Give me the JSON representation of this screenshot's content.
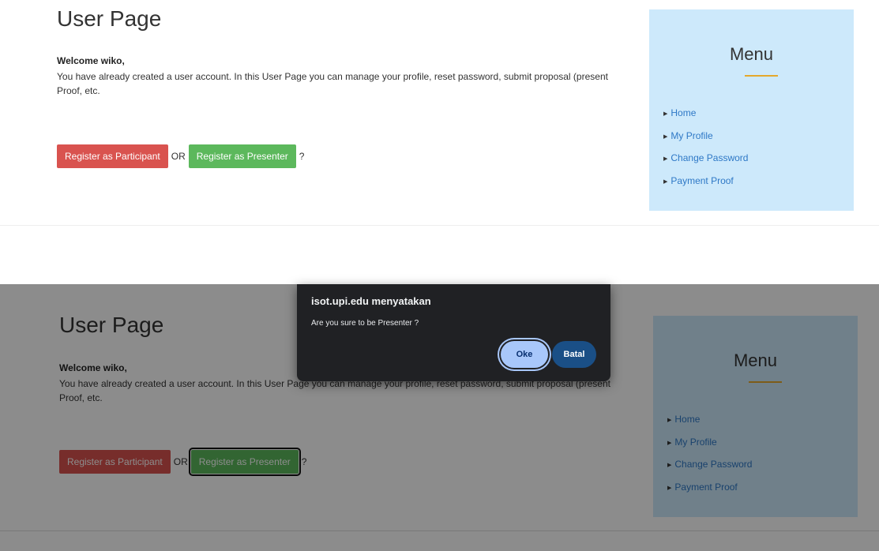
{
  "page": {
    "title": "User Page",
    "welcome": "Welcome wiko,",
    "description": "You have already created a user account. In this User Page you can manage your profile, reset password, submit proposal (present",
    "description_line2": "Proof, etc.",
    "register_participant_label": "Register as Participant",
    "or_text": "OR",
    "register_presenter_label": "Register as Presenter",
    "question_mark": "?"
  },
  "sidebar": {
    "title": "Menu",
    "items": [
      {
        "label": "Home"
      },
      {
        "label": "My Profile"
      },
      {
        "label": "Change Password"
      },
      {
        "label": "Payment Proof"
      }
    ]
  },
  "dialog": {
    "origin": "isot.upi.edu menyatakan",
    "message": "Are you sure to be Presenter ?",
    "ok_label": "Oke",
    "cancel_label": "Batal"
  },
  "colors": {
    "participant_button": "#d9534f",
    "presenter_button": "#5cb85c",
    "sidebar_bg": "#cde9fb",
    "menu_accent": "#e4a82c",
    "dialog_bg": "#202124"
  }
}
